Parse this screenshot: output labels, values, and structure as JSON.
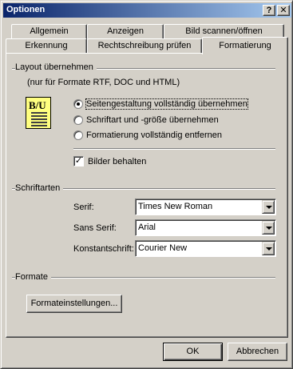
{
  "window": {
    "title": "Optionen",
    "help_button": "?",
    "close_button": "✕"
  },
  "tabs": {
    "row1": [
      "Allgemein",
      "Anzeigen",
      "Bild scannen/öffnen"
    ],
    "row2": [
      "Erkennung",
      "Rechtschreibung prüfen",
      "Formatierung"
    ],
    "active": "Formatierung"
  },
  "layout_group": {
    "label": "Layout übernehmen",
    "note": "(nur für Formate RTF, DOC und HTML)",
    "icon_letters": "B/U",
    "radio_options": [
      {
        "label": "Seitengestaltung vollständig übernehmen",
        "checked": true
      },
      {
        "label": "Schriftart und -größe übernehmen",
        "checked": false
      },
      {
        "label": "Formatierung vollständig entfernen",
        "checked": false
      }
    ],
    "keep_images": {
      "label": "Bilder behalten",
      "checked": true,
      "check_glyph": "✓"
    }
  },
  "fonts_group": {
    "label": "Schriftarten",
    "serif_label": "Serif:",
    "serif_value": "Times New Roman",
    "sans_label": "Sans Serif:",
    "sans_value": "Arial",
    "mono_label": "Konstantschrift:",
    "mono_value": "Courier New"
  },
  "formats_group": {
    "label": "Formate",
    "settings_button": "Formateinstellungen..."
  },
  "footer": {
    "ok": "OK",
    "cancel": "Abbrechen"
  },
  "colors": {
    "face": "#d4d0c8",
    "title_start": "#0a246a",
    "title_end": "#a6caf0",
    "icon_bg": "#ffff80"
  }
}
